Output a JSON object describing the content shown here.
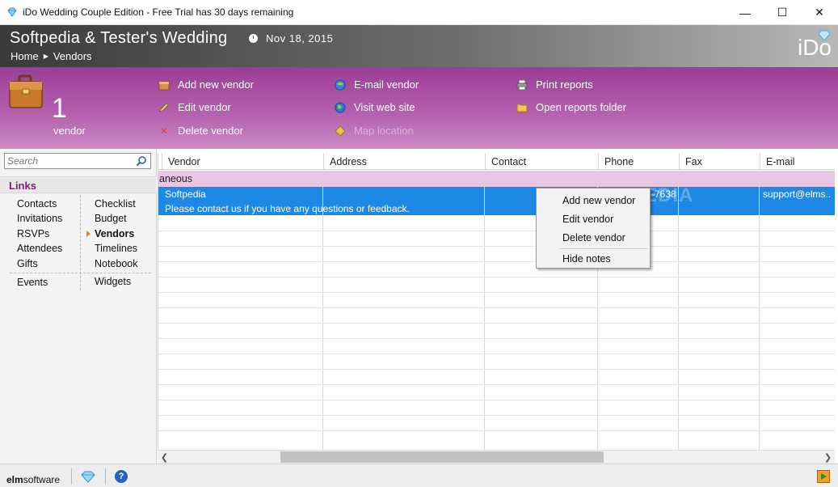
{
  "window": {
    "title": "iDo Wedding Couple Edition - Free Trial has 30 days remaining",
    "minimize": "—",
    "maximize": "☐",
    "close": "✕"
  },
  "header": {
    "wedding_title": "Softpedia & Tester's Wedding",
    "date": "Nov 18, 2015",
    "breadcrumb": [
      "Home",
      "Vendors"
    ],
    "logo": "iDo"
  },
  "toolbar": {
    "count": "1",
    "count_label": "vendor",
    "actions": [
      {
        "label": "Add new vendor",
        "icon": "box-icon",
        "enabled": true
      },
      {
        "label": "Edit vendor",
        "icon": "pencil-icon",
        "enabled": true
      },
      {
        "label": "Delete vendor",
        "icon": "delete-x-icon",
        "enabled": true
      },
      {
        "label": "E-mail vendor",
        "icon": "globe-mail-icon",
        "enabled": true
      },
      {
        "label": "Visit web site",
        "icon": "globe-icon",
        "enabled": true
      },
      {
        "label": "Map location",
        "icon": "map-sign-icon",
        "enabled": false
      },
      {
        "label": "Print reports",
        "icon": "printer-icon",
        "enabled": true
      },
      {
        "label": "Open reports folder",
        "icon": "folder-icon",
        "enabled": true
      }
    ]
  },
  "sidebar": {
    "search_placeholder": "Search",
    "links_title": "Links",
    "left_col": [
      "Contacts",
      "Invitations",
      "RSVPs",
      "Attendees",
      "Gifts",
      "Events"
    ],
    "right_col": [
      "Checklist",
      "Budget",
      "Vendors",
      "Timelines",
      "Notebook",
      "Widgets"
    ],
    "active": "Vendors"
  },
  "grid": {
    "columns": [
      "Vendor",
      "Address",
      "Contact",
      "Phone",
      "Fax",
      "E-mail"
    ],
    "group_label": "aneous",
    "rows": [
      {
        "vendor": "Softpedia",
        "phone": "-7638",
        "email": "support@elms..",
        "note": "Please contact us if you have any questions or feedback."
      }
    ]
  },
  "context_menu": {
    "items": [
      "Add new vendor",
      "Edit vendor",
      "Delete vendor",
      "Hide notes"
    ]
  },
  "watermark": "SOFTPEDIA",
  "footer": {
    "brand_prefix": "elm",
    "brand_suffix": "software",
    "help": "?"
  }
}
